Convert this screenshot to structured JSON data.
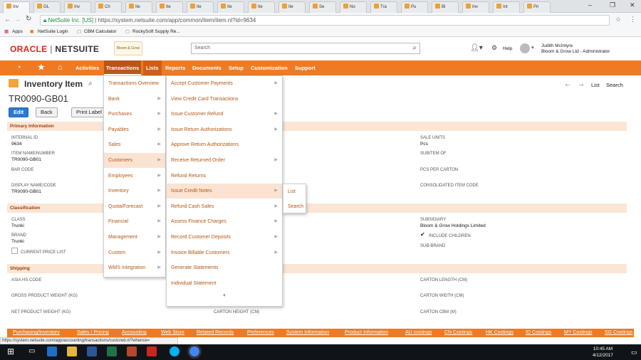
{
  "browser": {
    "tabs": [
      "Inv",
      "GL",
      "Inv",
      "Ch",
      "Ite",
      "Ite",
      "Ite",
      "Ite",
      "Ite",
      "Ite",
      "Se",
      "No",
      "Tra",
      "Pu",
      "Bl",
      "Inv",
      "Int",
      "Pri"
    ],
    "url_secure": "NetSuite Inc. [US]",
    "url": "https://system.netsuite.com/app/common/item/item.nl?id=9634",
    "bookmarks": [
      "Apps",
      "NetSuite Login",
      "CBM Calculator",
      "RockySoft Supply Re..."
    ]
  },
  "header": {
    "logo_oracle": "ORACLE",
    "logo_netsuite": "NETSUITE",
    "company_logo_text": "Bloom & Grow",
    "search_placeholder": "Search",
    "help": "Help",
    "user_name": "Judith McIntyre",
    "user_role": "Bloom & Grow Ltd - Administrator"
  },
  "nav": {
    "items": [
      "Activities",
      "Transactions",
      "Lists",
      "Reports",
      "Documents",
      "Setup",
      "Customization",
      "Support"
    ]
  },
  "page": {
    "title": "Inventory Item",
    "record_name": "TR0090-GB01",
    "edit": "Edit",
    "back": "Back",
    "print_label": "Print Label",
    "list": "List",
    "search": "Search"
  },
  "sections": {
    "primary": "Primary Information",
    "classification": "Classification",
    "shipping": "Shipping"
  },
  "fields": {
    "internal_id_label": "INTERNAL ID",
    "internal_id": "9634",
    "item_name_label": "ITEM NAME/NUMBER",
    "item_name": "TR0090-GB01",
    "bar_code_label": "BAR CODE",
    "display_name_label": "DISPLAY NAME/CODE",
    "display_name": "TR0090-GB01",
    "sale_units_label": "SALE UNITS",
    "sale_units": "Pcs",
    "subitem_of_label": "SUBITEM OF",
    "pcs_per_carton_label": "PCS PER CARTON",
    "consolidated_label": "CONSOLIDATED ITEM CODE",
    "class_label": "CLASS",
    "class": "Trunki",
    "brand_label": "BRAND",
    "brand": "Trunki",
    "current_price_list_label": "CURRENT PRICE LIST",
    "subsidiary_label": "SUBSIDIARY",
    "subsidiary": "Bloom & Grow Holdings Limited",
    "include_children_label": "INCLUDE CHILDREN",
    "sub_brand_label": "SUB-BRAND",
    "asia_hs_label": "ASIA HS CODE",
    "gross_weight_label": "GROSS PRODUCT WEIGHT (KG)",
    "net_weight_label": "NET PRODUCT WEIGHT (KG)",
    "carton_height_label": "CARTON HEIGHT (CM)",
    "carton_length_label": "CARTON LENGTH (CM)",
    "carton_width_label": "CARTON WIDTH (CM)",
    "carton_cbm_label": "CARTON CBM (M)"
  },
  "menus": {
    "lists": [
      "Transactions Overview",
      "Bank",
      "Purchases",
      "Payables",
      "Sales",
      "Customers",
      "Employees",
      "Inventory",
      "Quota/Forecast",
      "Financial",
      "Management",
      "Custom",
      "WMS Integration"
    ],
    "customers": [
      "Accept Customer Payments",
      "View Credit Card Transactions",
      "Issue Customer Refund",
      "Issue Return Authorizations",
      "Approve Return Authorizations",
      "Receive Returned Order",
      "Refund Returns",
      "Issue Credit Notes",
      "Refund Cash Sales",
      "Assess Finance Charges",
      "Record Customer Deposits",
      "Invoice Billable Customers",
      "Generate Statements",
      "Individual Statement"
    ],
    "credit_notes": [
      "List",
      "Search"
    ]
  },
  "subtabs": [
    "Purchasing/Inventory",
    "Sales / Pricing",
    "Accounting",
    "Web Store",
    "Related Records",
    "Preferences",
    "System Information",
    "Product Information",
    "AU costings",
    "CN Costings",
    "HK Costings",
    "ID Costings",
    "MY Costings",
    "SG Costings"
  ],
  "status_url": "https://system.netsuite.com/app/accounting/transactions/custcred.nl?whence=",
  "clock": {
    "time": "10:45 AM",
    "date": "4/12/2017"
  }
}
